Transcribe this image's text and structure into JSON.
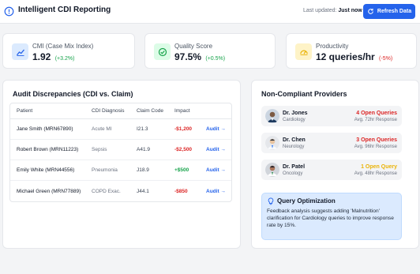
{
  "header": {
    "title": "Intelligent CDI Reporting",
    "last_updated_label": "Last updated:",
    "last_updated_value": "Just now",
    "refresh_label": "Refresh Data"
  },
  "kpis": [
    {
      "label": "CMI (Case Mix Index)",
      "value": "1.92",
      "delta": "(+3.2%)",
      "icon": "chart-trend-icon",
      "accent": "#2563eb"
    },
    {
      "label": "Quality Score",
      "value": "97.5%",
      "delta": "(+0.5%)",
      "icon": "check-circle-icon",
      "accent": "#16a34a"
    },
    {
      "label": "Productivity",
      "value": "12 queries/hr",
      "delta": "(-5%)",
      "icon": "speedometer-icon",
      "accent": "#eab308"
    }
  ],
  "audit": {
    "title": "Audit Discrepancies (CDI vs. Claim)",
    "columns": [
      "Patient",
      "CDI Diagnosis",
      "Claim Code",
      "Impact"
    ],
    "rows": [
      {
        "patient": "Jane Smith (MRN67890)",
        "diagnosis": "Acute MI",
        "code": "I21.3",
        "impact": "-$1,200",
        "action": "Audit"
      },
      {
        "patient": "Robert Brown (MRN11223)",
        "diagnosis": "Sepsis",
        "code": "A41.9",
        "impact": "-$2,500",
        "action": "Audit"
      },
      {
        "patient": "Emily White (MRN44556)",
        "diagnosis": "Pneumonia",
        "code": "J18.9",
        "impact": "+$500",
        "action": "Audit"
      },
      {
        "patient": "Michael Green (MRN77889)",
        "diagnosis": "COPD Exac.",
        "code": "J44.1",
        "impact": "-$850",
        "action": "Audit"
      }
    ]
  },
  "providers": {
    "title": "Non-Compliant Providers",
    "items": [
      {
        "name": "Dr. Jones",
        "dept": "Cardiology",
        "queries": "4 Open Queries",
        "response": "Avg. 72hr Response",
        "color": "#dc2626"
      },
      {
        "name": "Dr. Chen",
        "dept": "Neurology",
        "queries": "3 Open Queries",
        "response": "Avg. 96hr Response",
        "color": "#dc2626"
      },
      {
        "name": "Dr. Patel",
        "dept": "Oncology",
        "queries": "1 Open Query",
        "response": "Avg. 48hr Response",
        "color": "#eab308"
      }
    ]
  },
  "insight": {
    "title": "Query Optimization",
    "body": "Feedback analysis suggests adding 'Malnutrition' clarification for Cardiology queries to improve response rate by 15%."
  },
  "colors": {
    "primary": "#2563eb",
    "negative": "#dc2626",
    "positive": "#16a34a",
    "warning": "#eab308"
  }
}
